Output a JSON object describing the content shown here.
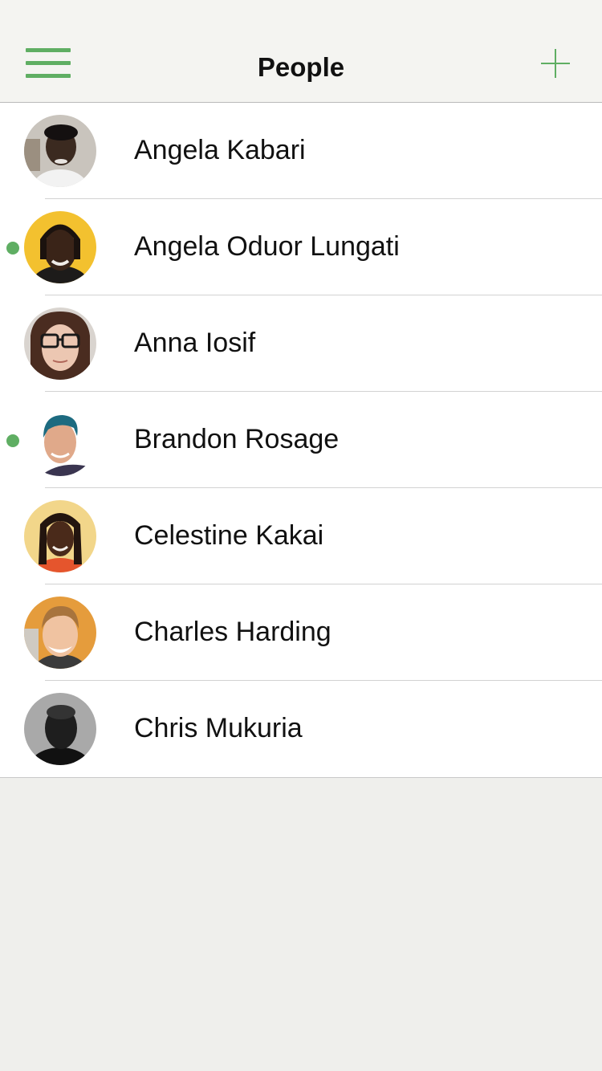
{
  "header": {
    "title": "People",
    "menu_icon": "hamburger-menu-icon",
    "add_icon": "plus-icon",
    "accent_color": "#5fae63"
  },
  "people": [
    {
      "name": "Angela Kabari",
      "online": false
    },
    {
      "name": "Angela Oduor Lungati",
      "online": true
    },
    {
      "name": "Anna Iosif",
      "online": false
    },
    {
      "name": "Brandon Rosage",
      "online": true
    },
    {
      "name": "Celestine Kakai",
      "online": false
    },
    {
      "name": "Charles Harding",
      "online": false
    },
    {
      "name": "Chris Mukuria",
      "online": false
    }
  ]
}
